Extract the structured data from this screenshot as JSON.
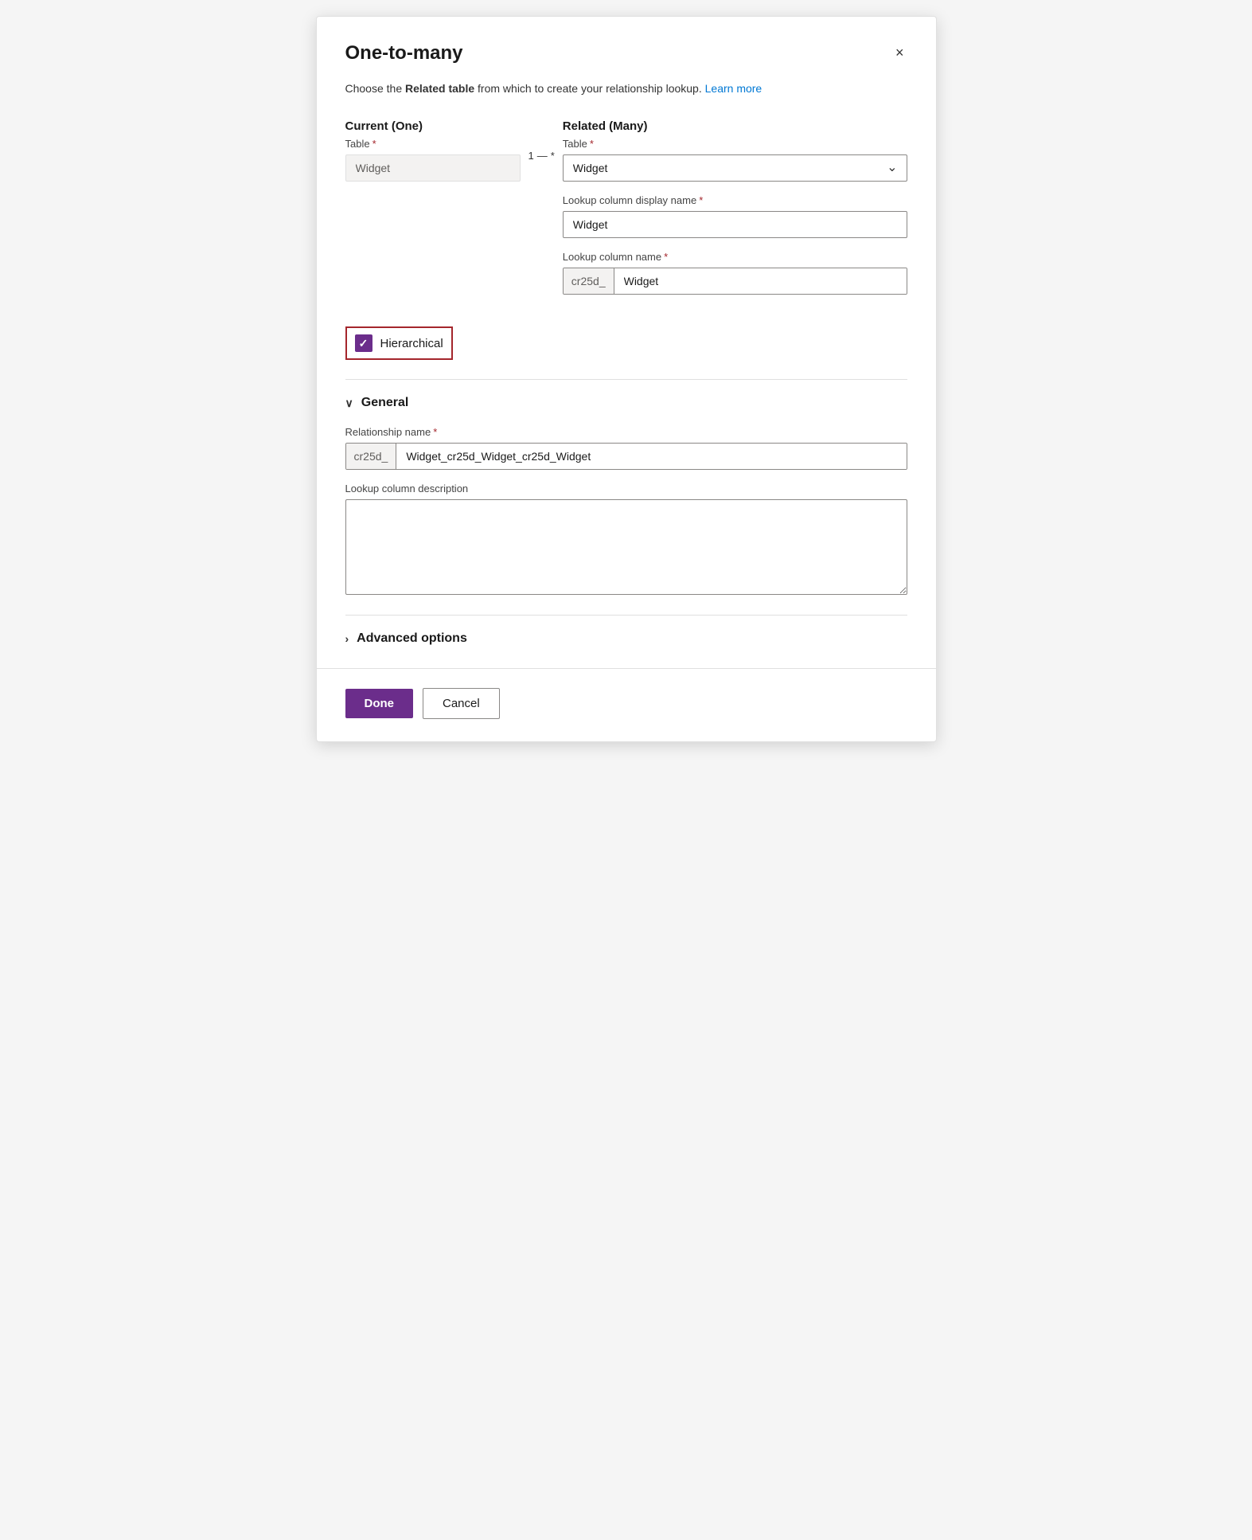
{
  "dialog": {
    "title": "One-to-many",
    "close_label": "×",
    "description_text": "Choose the ",
    "description_bold": "Related table",
    "description_after": " from which to create your relationship lookup.",
    "learn_more": "Learn more"
  },
  "current_column": {
    "heading": "Current (One)",
    "table_label": "Table",
    "table_value": "Widget"
  },
  "connector": {
    "from": "1",
    "line": "—",
    "to": "*"
  },
  "related_column": {
    "heading": "Related (Many)",
    "table_label": "Table",
    "table_value": "Widget",
    "lookup_display_label": "Lookup column display name",
    "lookup_display_value": "Widget",
    "lookup_name_label": "Lookup column name",
    "lookup_name_prefix": "cr25d_",
    "lookup_name_value": "Widget"
  },
  "hierarchical": {
    "label": "Hierarchical",
    "checked": true
  },
  "general_section": {
    "label": "General",
    "expanded": true,
    "relationship_name_label": "Relationship name",
    "relationship_name_prefix": "cr25d_",
    "relationship_name_value": "Widget_cr25d_Widget_cr25d_Widget",
    "description_label": "Lookup column description",
    "description_value": ""
  },
  "advanced_section": {
    "label": "Advanced options",
    "expanded": false
  },
  "footer": {
    "done_label": "Done",
    "cancel_label": "Cancel"
  }
}
